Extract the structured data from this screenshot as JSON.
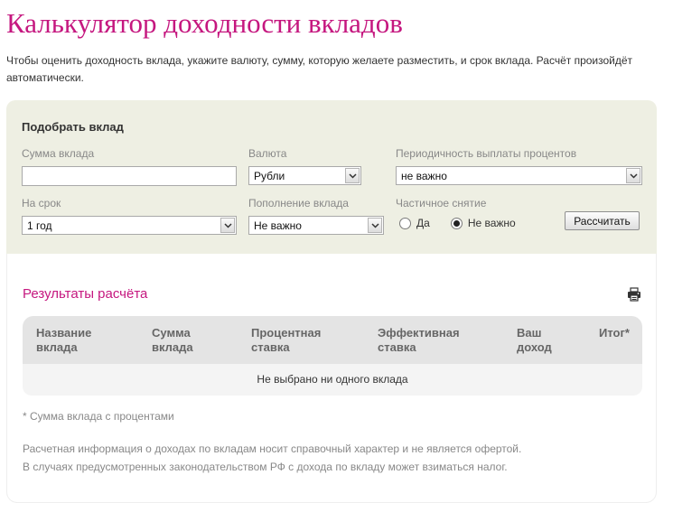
{
  "page": {
    "title": "Калькулятор доходности вкладов",
    "intro": "Чтобы оценить доходность вклада, укажите валюту, сумму, которую желаете разместить, и срок вклада. Расчёт произойдёт автоматически."
  },
  "form": {
    "title": "Подобрать вклад",
    "amount": {
      "label": "Сумма вклада",
      "value": "",
      "placeholder": ""
    },
    "currency": {
      "label": "Валюта",
      "selected": "Рубли"
    },
    "payout": {
      "label": "Периодичность выплаты процентов",
      "selected": "не важно"
    },
    "term": {
      "label": "На срок",
      "selected": "1 год"
    },
    "topup": {
      "label": "Пополнение вклада",
      "selected": "Не важно"
    },
    "withdrawal": {
      "label": "Частичное снятие",
      "options": [
        {
          "label": "Да",
          "checked": false
        },
        {
          "label": "Не важно",
          "checked": true
        }
      ]
    },
    "calculate_label": "Рассчитать"
  },
  "results": {
    "title": "Результаты расчёта",
    "print_icon": "printer-icon",
    "columns": [
      {
        "line1": "Название",
        "line2": "вклада"
      },
      {
        "line1": "Сумма",
        "line2": "вклада"
      },
      {
        "line1": "Процентная",
        "line2": "ставка"
      },
      {
        "line1": "Эффективная",
        "line2": "ставка"
      },
      {
        "line1": "Ваш",
        "line2": "доход"
      },
      {
        "line1": "Итог*",
        "line2": ""
      }
    ],
    "empty_message": "Не выбрано ни одного вклада",
    "footnote": "* Сумма вклада с процентами",
    "disclaimer": [
      "Расчетная информация о доходах по вкладам носит справочный характер и не является офертой.",
      "В случаях предусмотренных законодательством РФ с дохода по вкладу может взиматься налог."
    ]
  },
  "colors": {
    "accent": "#c5177f",
    "form_background": "#eeefe3",
    "table_header": "#e4e4e4",
    "table_body": "#f4f4f4"
  }
}
